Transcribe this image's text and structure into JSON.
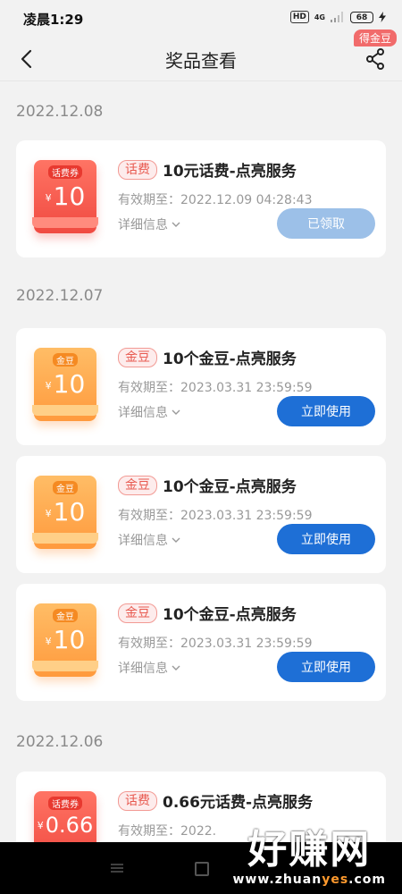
{
  "status": {
    "time": "凌晨1:29",
    "hd": "HD",
    "net": "4G",
    "battery": "68"
  },
  "nav": {
    "title": "奖品查看",
    "badge": "得金豆"
  },
  "groups": [
    {
      "date": "2022.12.08"
    },
    {
      "date": "2022.12.07"
    },
    {
      "date": "2022.12.06"
    }
  ],
  "cards": [
    {
      "coupon_tag": "话费券",
      "currency": "¥",
      "amount": "10",
      "category": "话费",
      "name": "10元话费-点亮服务",
      "expiry": "有效期至：2022.12.09 04:28:43",
      "detail": "详细信息",
      "action": "已领取",
      "coupon_color": "red"
    },
    {
      "coupon_tag": "金豆",
      "currency": "¥",
      "amount": "10",
      "category": "金豆",
      "name": "10个金豆-点亮服务",
      "expiry": "有效期至：2023.03.31 23:59:59",
      "detail": "详细信息",
      "action": "立即使用",
      "coupon_color": "orange"
    },
    {
      "coupon_tag": "金豆",
      "currency": "¥",
      "amount": "10",
      "category": "金豆",
      "name": "10个金豆-点亮服务",
      "expiry": "有效期至：2023.03.31 23:59:59",
      "detail": "详细信息",
      "action": "立即使用",
      "coupon_color": "orange"
    },
    {
      "coupon_tag": "金豆",
      "currency": "¥",
      "amount": "10",
      "category": "金豆",
      "name": "10个金豆-点亮服务",
      "expiry": "有效期至：2023.03.31 23:59:59",
      "detail": "详细信息",
      "action": "立即使用",
      "coupon_color": "orange"
    },
    {
      "coupon_tag": "话费券",
      "currency": "¥",
      "amount": "0.66",
      "category": "话费",
      "name": "0.66元话费-点亮服务",
      "expiry": "有效期至：2022.",
      "detail": "",
      "action": "",
      "coupon_color": "red"
    }
  ],
  "watermark": {
    "main": "好赚网",
    "sub_a": "www.zhuan",
    "sub_b": "yes",
    "sub_c": ".com"
  },
  "colors": {
    "primary_button": "#1e6fd6",
    "claimed_button": "#9cc0e8",
    "tag_red": "#e85a50"
  }
}
